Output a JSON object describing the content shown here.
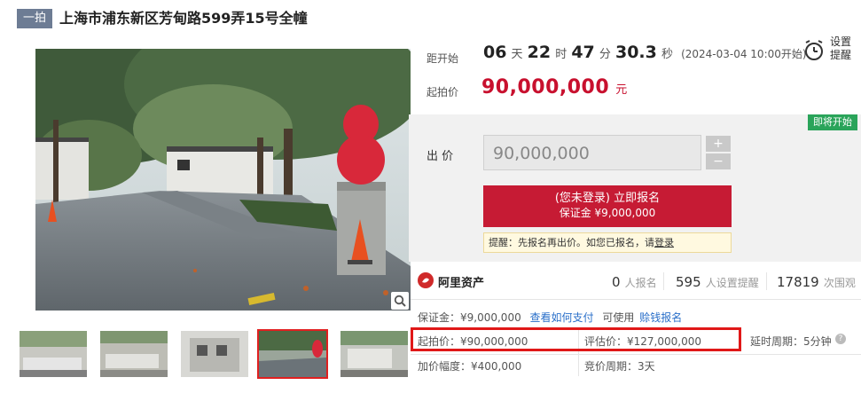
{
  "header": {
    "badge": "一拍",
    "title": "上海市浦东新区芳甸路599弄15号全幢"
  },
  "countdown": {
    "label": "距开始",
    "days": "06",
    "days_unit": "天",
    "hours": "22",
    "hours_unit": "时",
    "minutes": "47",
    "minutes_unit": "分",
    "seconds": "30.3",
    "seconds_unit": "秒",
    "start_note": "(2024-03-04 10:00开始)"
  },
  "start_price": {
    "label": "起拍价",
    "value": "90,000,000",
    "unit": "元"
  },
  "reminder": {
    "label_line1": "设置",
    "label_line2": "提醒"
  },
  "bid": {
    "status_badge": "即将开始",
    "label": "出 价",
    "input_value": "90,000,000",
    "plus": "+",
    "minus": "−",
    "register_line1": "(您未登录) 立即报名",
    "register_line2": "保证金 ¥9,000,000",
    "tip_text": "提醒：先报名再出价。如您已报名，请",
    "tip_link": "登录"
  },
  "stats": {
    "brand": "阿里资产",
    "registered_num": "0",
    "registered_label": "人报名",
    "reminders_num": "595",
    "reminders_label": "人设置提醒",
    "views_num": "17819",
    "views_label": "次围观"
  },
  "info": {
    "deposit": "保证金：¥9,000,000",
    "deposit_link": "查看如何支付",
    "usable": "可使用",
    "usable_link": "赊钱报名",
    "start_price": "起拍价：¥90,000,000",
    "appraisal": "评估价：¥127,000,000",
    "delay": "延时周期：5分钟",
    "increment": "加价幅度：¥400,000",
    "cycle": "竞价周期：3天"
  },
  "colors": {
    "accent_red": "#c61b34",
    "price_red": "#c8102e",
    "badge_green": "#2aa45a",
    "highlight_box": "#e01818"
  },
  "icons": {
    "zoom": "magnifier-icon",
    "reminder": "alarm-clock-icon",
    "brand": "ali-asset-logo",
    "help": "question-icon"
  }
}
